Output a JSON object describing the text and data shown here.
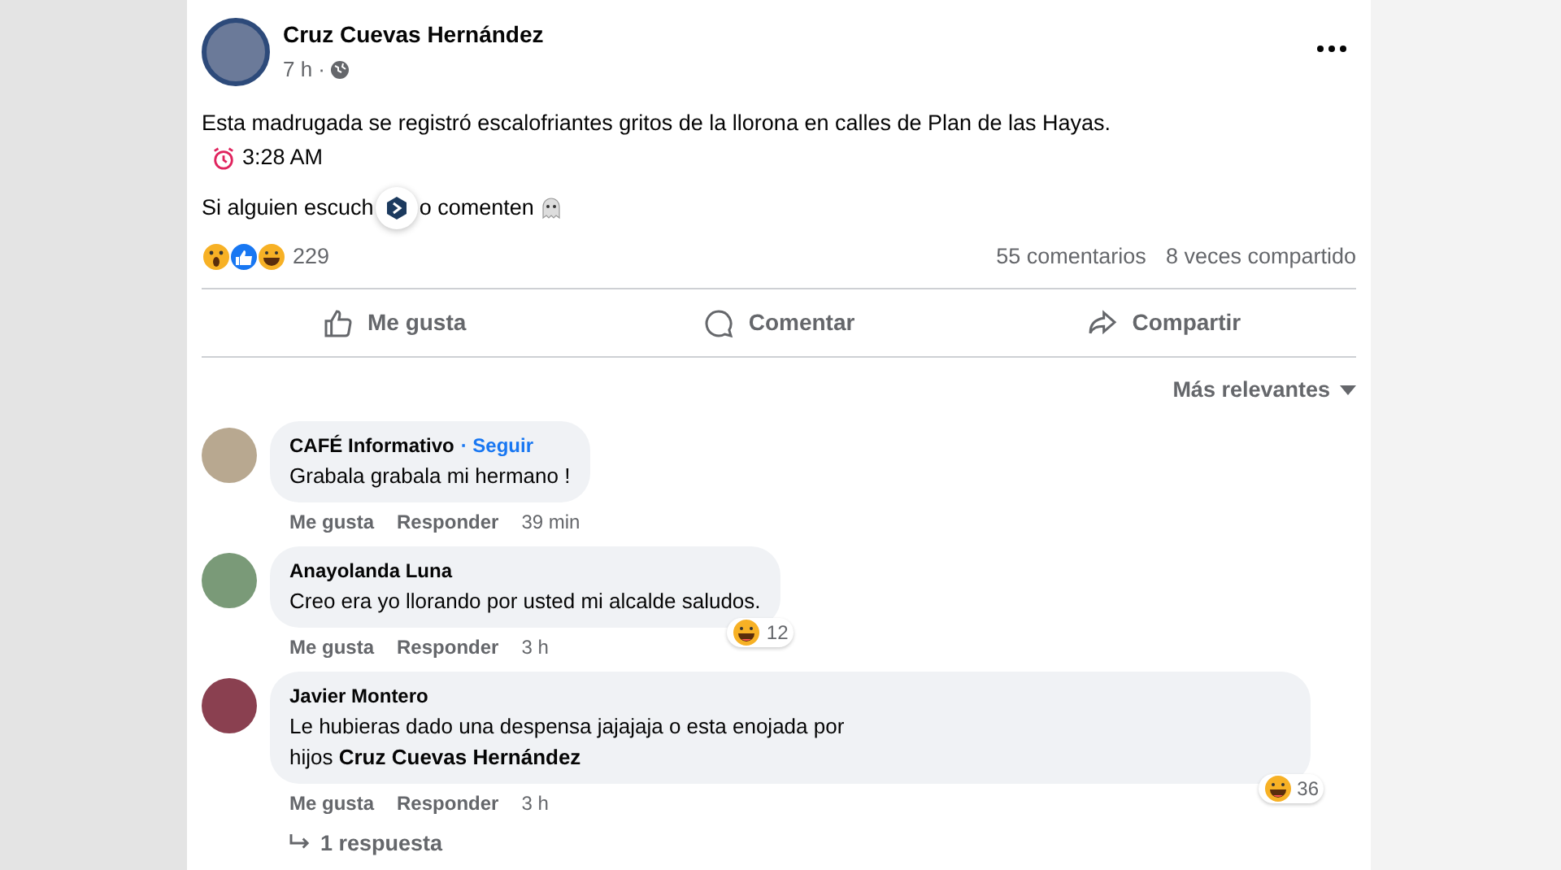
{
  "post": {
    "author": "Cruz Cuevas Hernández",
    "time": "7 h ·",
    "text": "Esta madrugada se registró escalofriantes gritos de la llorona en calles de Plan de las Hayas.",
    "clock_line": "3:28 AM",
    "question_start": "Si alguien escuch",
    "question_end": "o comenten",
    "reaction_count": "229",
    "comments_count": "55 comentarios",
    "shares_count": "8 veces compartido",
    "actions": [
      {
        "kind": "like",
        "label": "Me gusta"
      },
      {
        "kind": "comment",
        "label": "Comentar"
      },
      {
        "kind": "share",
        "label": "Compartir"
      }
    ]
  },
  "sort": "Más relevantes",
  "comments": [
    {
      "author": "CAFÉ Informativo",
      "follow": "· Seguir",
      "lines": [
        "Grabala grabala mi hermano !"
      ],
      "like": "Me gusta",
      "reply": "Responder",
      "time": "39 min"
    },
    {
      "author": "Anayolanda Luna",
      "lines": [
        "Creo era yo llorando por usted mi alcalde saludos."
      ],
      "like": "Me gusta",
      "reply": "Responder",
      "time": "3 h",
      "reaction_count": "12"
    },
    {
      "author": "Javier Montero",
      "lines": [
        "Le hubieras dado una despensa jajajaja o esta enojada por",
        "hijos **Cruz Cuevas Hernández**"
      ],
      "like": "Me gusta",
      "reply": "Responder",
      "time": "3 h",
      "reaction_count": "36",
      "replies": "1 respuesta"
    }
  ]
}
